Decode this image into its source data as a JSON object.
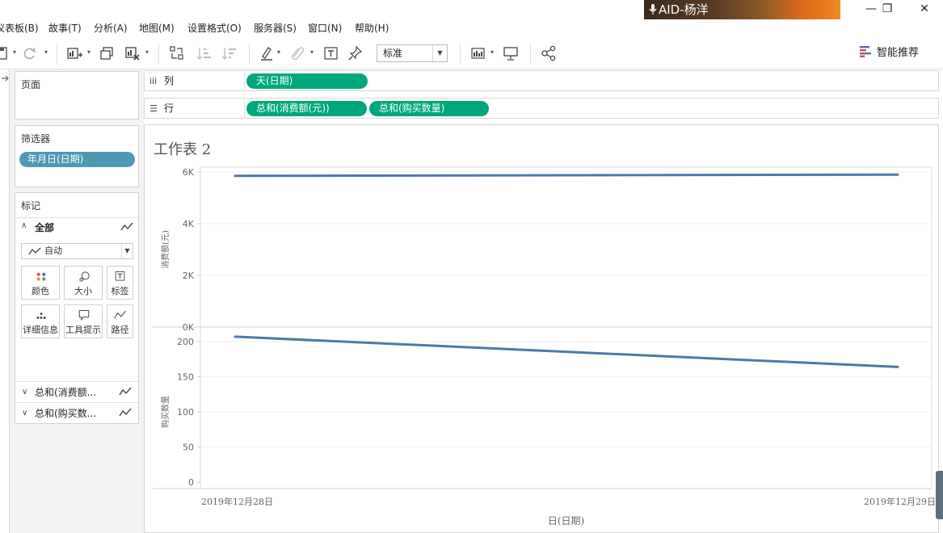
{
  "menubar": {
    "items": [
      "仪表板(B)",
      "故事(T)",
      "分析(A)",
      "地图(M)",
      "设置格式(O)",
      "服务器(S)",
      "窗口(N)",
      "帮助(H)"
    ],
    "badge": "AID-杨洋",
    "window_buttons": [
      "—",
      "❐",
      "✕"
    ]
  },
  "toolbar": {
    "fit_label": "标准",
    "smart_label": "智能推荐"
  },
  "pages_card": {
    "title": "页面"
  },
  "filters_card": {
    "title": "筛选器",
    "pill": "年月日(日期)"
  },
  "marks_card": {
    "title": "标记",
    "all_label": "全部",
    "mark_type": "自动",
    "buttons": [
      "颜色",
      "大小",
      "标签",
      "详细信息",
      "工具提示",
      "路径"
    ],
    "measures": [
      "总和(消费额...",
      "总和(购买数..."
    ]
  },
  "shelves": {
    "columns_label": "列",
    "rows_label": "行",
    "columns_pill": "天(日期)",
    "rows_pills": [
      "总和(消费额(元))",
      "总和(购买数量)"
    ]
  },
  "sheet": {
    "title": "工作表 2"
  },
  "chart_data": {
    "type": "line",
    "x": [
      "2019年12月28日",
      "2019年12月29日"
    ],
    "xlabel": "日(日期)",
    "line_color": "#4e79a7",
    "grid": true,
    "panes": [
      {
        "ylabel": "消费额(元)",
        "ylim": [
          0,
          6000
        ],
        "ticks": [
          0,
          2000,
          4000,
          6000
        ],
        "tick_labels": [
          "0K",
          "2K",
          "4K",
          "6K"
        ],
        "values": [
          5850,
          5900
        ]
      },
      {
        "ylabel": "购买数量",
        "ylim": [
          0,
          200
        ],
        "ticks": [
          0,
          50,
          100,
          150,
          200
        ],
        "tick_labels": [
          "0",
          "50",
          "100",
          "150",
          "200"
        ],
        "values": [
          207,
          164
        ]
      }
    ]
  }
}
